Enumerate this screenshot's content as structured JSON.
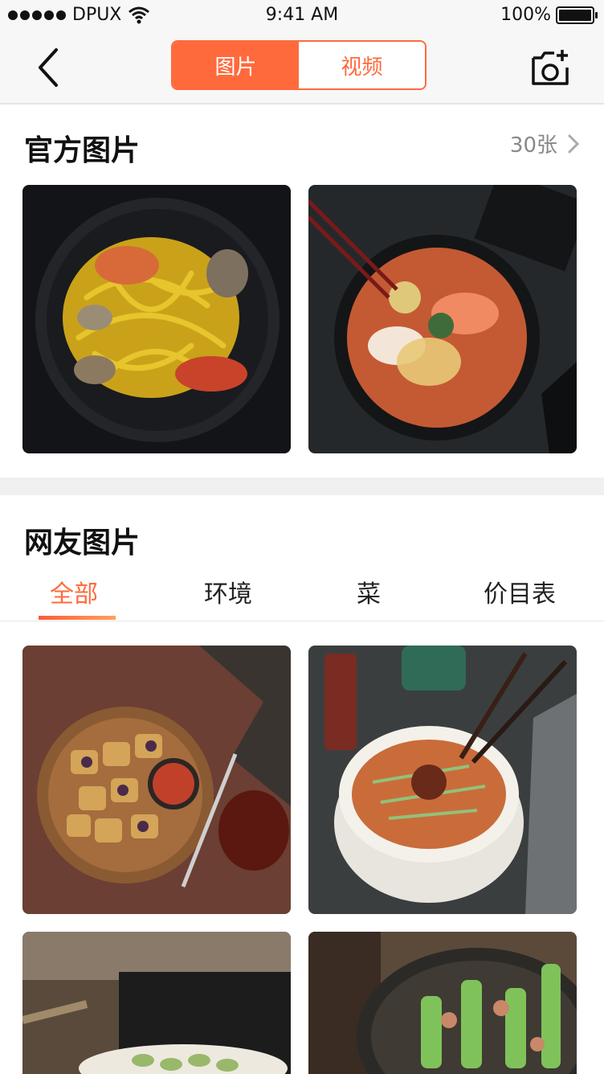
{
  "status": {
    "carrier": "DPUX",
    "time": "9:41 AM",
    "battery": "100%"
  },
  "nav": {
    "tab_photos": "图片",
    "tab_videos": "视频"
  },
  "official": {
    "title": "官方图片",
    "count": "30张"
  },
  "user": {
    "title": "网友图片",
    "tabs": [
      "全部",
      "环境",
      "菜",
      "价目表"
    ],
    "active_tab": 0
  },
  "colors": {
    "accent": "#ff6a3d",
    "divider": "#f0f0f0"
  }
}
